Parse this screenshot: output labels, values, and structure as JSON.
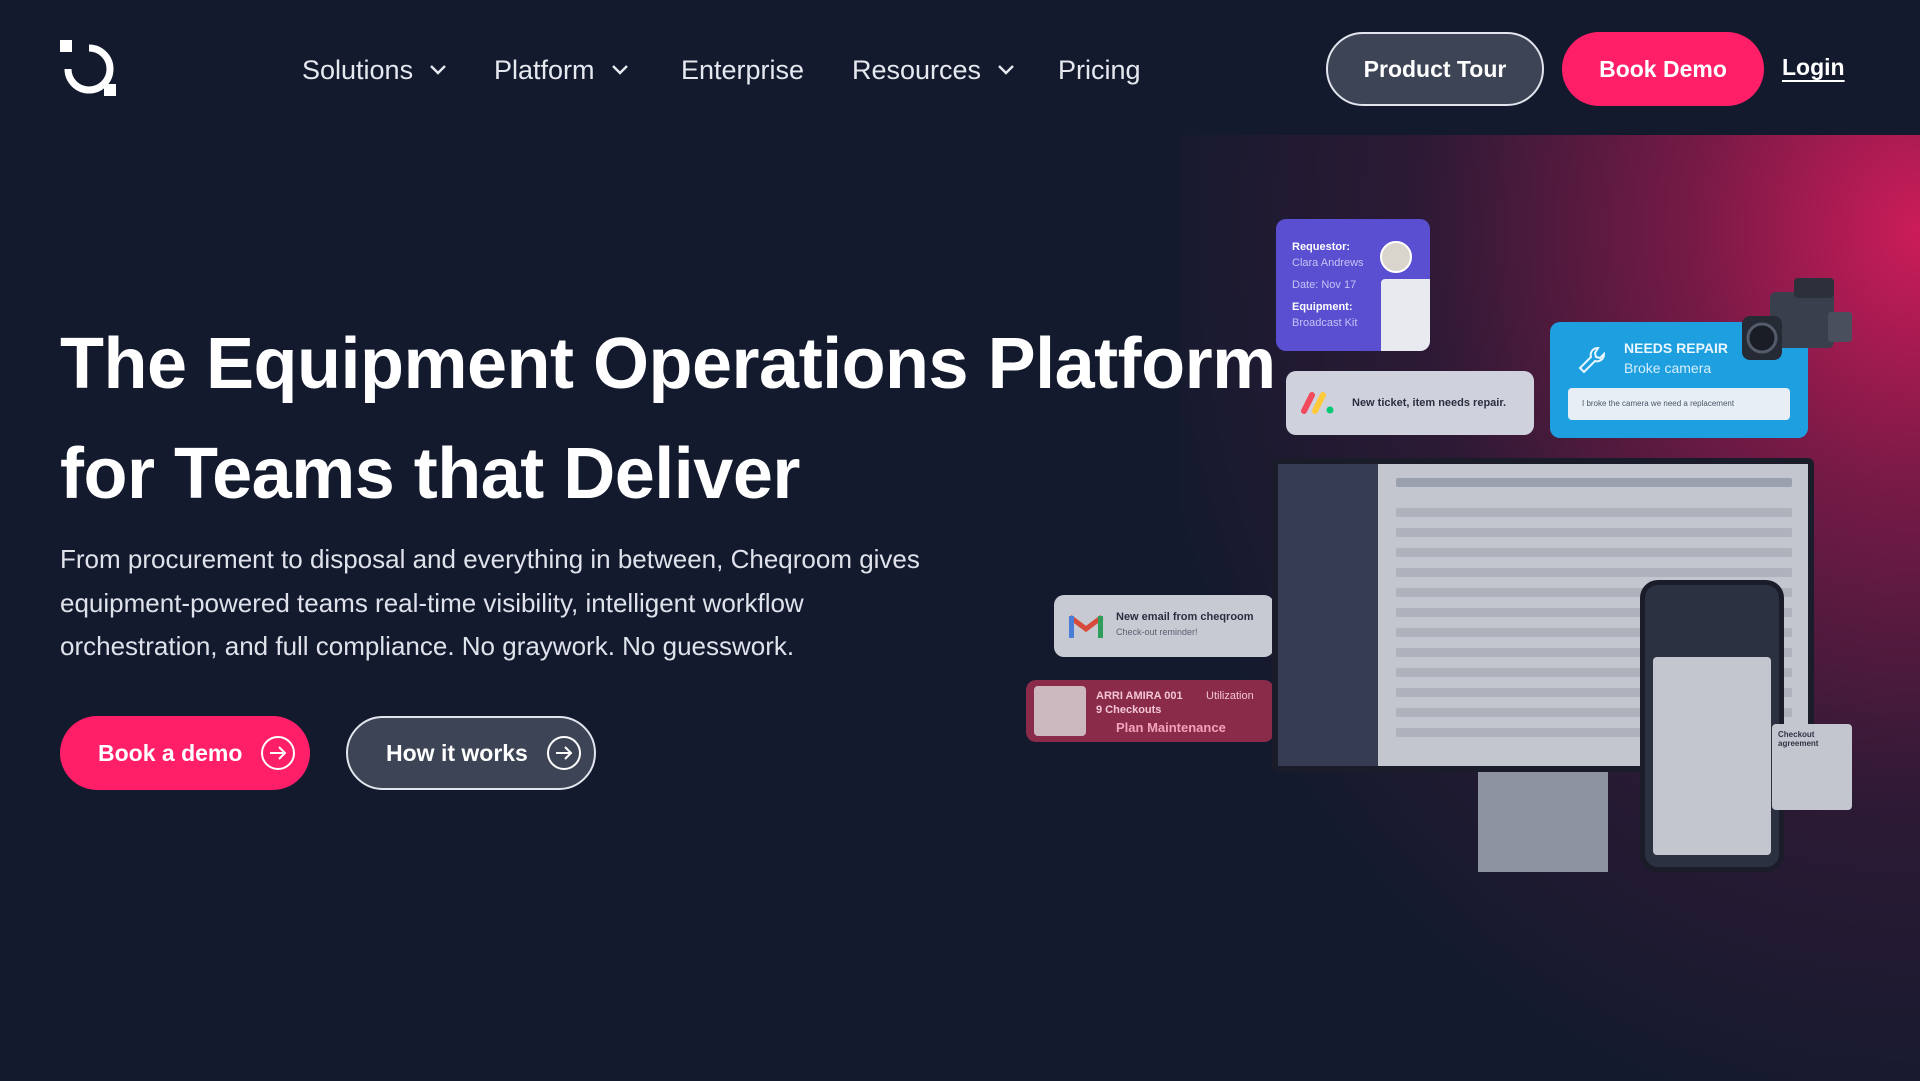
{
  "nav": {
    "items": [
      {
        "label": "Solutions",
        "has_dropdown": true
      },
      {
        "label": "Platform",
        "has_dropdown": true
      },
      {
        "label": "Enterprise",
        "has_dropdown": false
      },
      {
        "label": "Resources",
        "has_dropdown": true
      },
      {
        "label": "Pricing",
        "has_dropdown": false
      }
    ],
    "product_tour": "Product Tour",
    "book_demo": "Book Demo",
    "login": "Login"
  },
  "hero": {
    "title_line1": "The Equipment Operations Platform",
    "title_line2": "for Teams that Deliver",
    "subtitle_line1": "From procurement to disposal and everything in between, Cheqroom gives",
    "subtitle_line2": "equipment-powered teams real-time visibility, intelligent workflow",
    "subtitle_line3": "orchestration, and full compliance. No graywork. No guesswork.",
    "cta_primary": "Book a demo",
    "cta_secondary": "How it works"
  },
  "mockup": {
    "request": {
      "requestor_label": "Requestor:",
      "requestor_name": "Clara Andrews",
      "date": "Date: Nov 17",
      "equipment_label": "Equipment:",
      "equipment_name": "Broadcast Kit"
    },
    "ticket": "New ticket, item needs repair.",
    "repair": {
      "title": "NEEDS REPAIR",
      "subtitle": "Broke camera",
      "message": "I broke the camera we need a replacement"
    },
    "email": {
      "title": "New email from cheqroom",
      "subtitle": "Check-out reminder!"
    },
    "asset": {
      "name": "ARRI AMIRA 001",
      "metric": "Utilization",
      "checkouts": "9 Checkouts",
      "action": "Plan Maintenance"
    },
    "agreement": "Checkout agreement"
  },
  "colors": {
    "background": "#141a2e",
    "accent": "#ff1f68",
    "secondary_button": "#3d4456"
  }
}
